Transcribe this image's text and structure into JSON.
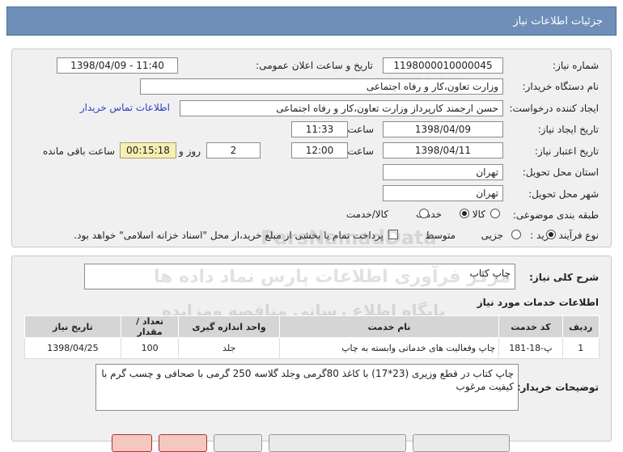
{
  "header": {
    "title": "جزئیات اطلاعات نیاز"
  },
  "form": {
    "need_number_label": "شماره نیاز:",
    "need_number": "1198000010000045",
    "announce_label": "تاریخ و ساعت اعلان عمومی:",
    "announce_value": "1398/04/09 - 11:40",
    "buyer_org_label": "نام دستگاه خریدار:",
    "buyer_org": "وزارت تعاون،کار و رفاه اجتماعی",
    "requester_label": "ایجاد کننده درخواست:",
    "requester": "حسن ارجمند کارپرداز وزارت تعاون،کار و رفاه اجتماعی",
    "contact_link": "اطلاعات تماس خریدار",
    "created_label": "تاریخ ایجاد نیاز:",
    "created_date": "1398/04/09",
    "time_label": "ساعت",
    "created_time": "11:33",
    "validity_label": "تاریخ اعتبار نیاز:",
    "validity_date": "1398/04/11",
    "validity_time": "12:00",
    "days_value": "2",
    "days_label": "روز و",
    "remaining_value": "00:15:18",
    "remaining_label": "ساعت باقی مانده",
    "province_label": "استان محل تحویل:",
    "province": "تهران",
    "city_label": "شهر محل تحویل:",
    "city": "تهران",
    "category_label": "طبقه بندی موضوعی:",
    "category_options": [
      "کالا",
      "خدمت",
      "کالا/خدمت"
    ],
    "category_selected": "خدمت",
    "process_label": "نوع فرآیند خرید :",
    "process_options": [
      "جزیی",
      "متوسط"
    ],
    "process_selected": "جزیی",
    "payment_note": "پرداخت تمام یا بخشی از مبلغ خرید،از محل \"اسناد خزانه اسلامی\" خواهد بود."
  },
  "details": {
    "summary_label": "شرح کلی نیاز:",
    "summary": "چاپ کتاب",
    "services_title": "اطلاعات خدمات مورد نیاز",
    "columns": [
      "ردیف",
      "کد خدمت",
      "نام خدمت",
      "واحد اندازه گیری",
      "تعداد / مقدار",
      "تاریخ نیاز"
    ],
    "rows": [
      [
        "1",
        "پ-18-181",
        "چاپ وفعالیت های خدماتی وابسته به چاپ",
        "جلد",
        "100",
        "1398/04/25"
      ]
    ],
    "buyer_desc_label": "توضیحات خریدار:",
    "buyer_desc": "چاپ کتاب در قطع وزیری (23*17) با کاغذ 80گرمی وجلد گلاسه 250 گرمی با صحافی و چسب گرم با کیفیت مرغوب"
  },
  "watermarks": {
    "top": "ParsNamadData",
    "middle": "مرکز فرآوری اطلاعات پارس نماد داده ها",
    "lower": "پایگاه اطلاع رسانی مناقصه ومزایده",
    "phone": "۰۲۱-۸۸۳۴۹۶۷۰"
  },
  "colors": {
    "header_bg": "#6f8fb8",
    "panel_bg": "#f0f0f0",
    "remaining_bg": "#f6efb4",
    "link": "#2a3fbf"
  }
}
